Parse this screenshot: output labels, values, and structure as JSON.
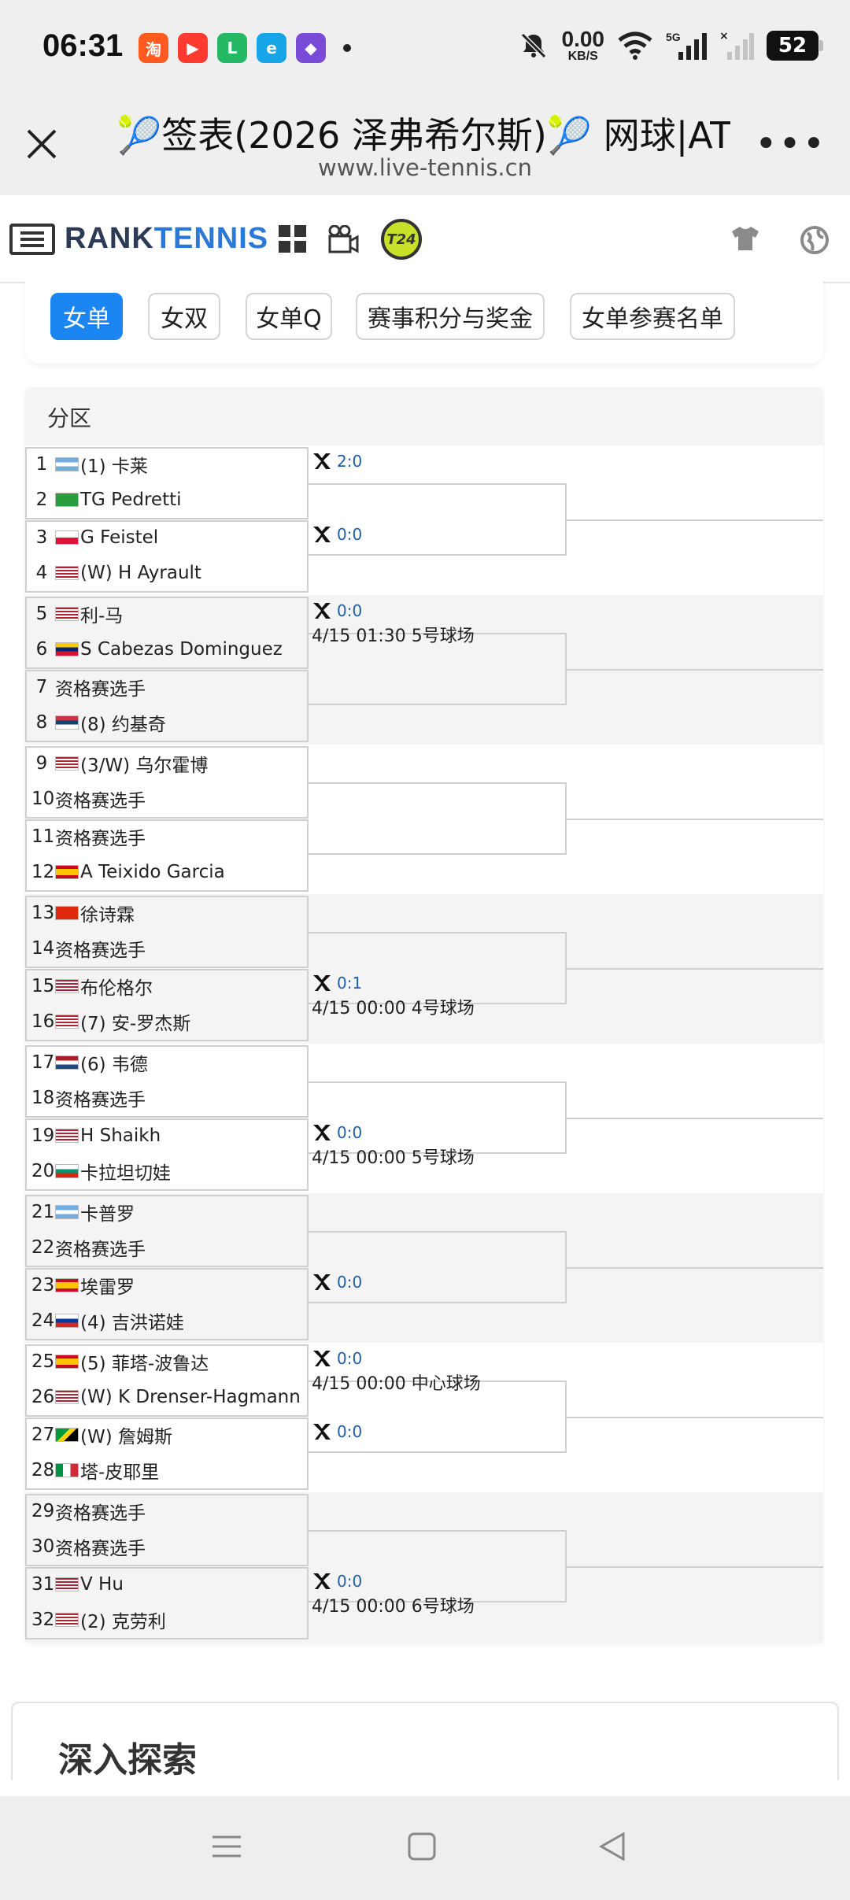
{
  "status": {
    "time": "06:31",
    "net_speed": "0.00",
    "net_unit": "KB/S",
    "network": "5G",
    "battery": "52",
    "apps": [
      {
        "icon": "taobao-app-icon",
        "glyph": "淘",
        "color": "#ff5a1f"
      },
      {
        "icon": "video-app-icon",
        "glyph": "▶",
        "color": "#ff3b30"
      },
      {
        "icon": "green-app-icon",
        "glyph": "L",
        "color": "#25b865"
      },
      {
        "icon": "browser-app-icon",
        "glyph": "e",
        "color": "#18a5e8"
      },
      {
        "icon": "game-app-icon",
        "glyph": "◆",
        "color": "#7a4bd6"
      }
    ]
  },
  "titlebar": {
    "title": "🎾签表(2026 泽弗希尔斯)🎾 网球|AT...",
    "url": "www.live-tennis.cn"
  },
  "site": {
    "brand_a": "RANK",
    "brand_b": "TENNIS",
    "t24": "T24"
  },
  "tabs": [
    {
      "label": "女单",
      "active": true
    },
    {
      "label": "女双",
      "active": false
    },
    {
      "label": "女单Q",
      "active": false
    },
    {
      "label": "赛事积分与奖金",
      "active": false
    },
    {
      "label": "女单参赛名单",
      "active": false
    }
  ],
  "bracket": {
    "section_label": "分区",
    "players": [
      {
        "num": "1",
        "flag": "ARG",
        "name": "(1) 卡莱"
      },
      {
        "num": "2",
        "flag": "BRA",
        "name": "TG Pedretti"
      },
      {
        "num": "3",
        "flag": "POL",
        "name": "G Feistel"
      },
      {
        "num": "4",
        "flag": "USA",
        "name": "(W) H Ayrault"
      },
      {
        "num": "5",
        "flag": "USA",
        "name": "利-马"
      },
      {
        "num": "6",
        "flag": "VEN",
        "name": "S Cabezas Dominguez"
      },
      {
        "num": "7",
        "flag": "",
        "name": "资格赛选手"
      },
      {
        "num": "8",
        "flag": "SRB",
        "name": "(8) 约基奇"
      },
      {
        "num": "9",
        "flag": "USA",
        "name": "(3/W) 乌尔霍博"
      },
      {
        "num": "10",
        "flag": "",
        "name": "资格赛选手"
      },
      {
        "num": "11",
        "flag": "",
        "name": "资格赛选手"
      },
      {
        "num": "12",
        "flag": "ESP",
        "name": "A Teixido Garcia"
      },
      {
        "num": "13",
        "flag": "CHN",
        "name": "徐诗霖"
      },
      {
        "num": "14",
        "flag": "",
        "name": "资格赛选手"
      },
      {
        "num": "15",
        "flag": "USA",
        "name": "布伦格尔"
      },
      {
        "num": "16",
        "flag": "USA",
        "name": "(7) 安-罗杰斯"
      },
      {
        "num": "17",
        "flag": "NED",
        "name": "(6) 韦德"
      },
      {
        "num": "18",
        "flag": "",
        "name": "资格赛选手"
      },
      {
        "num": "19",
        "flag": "USA",
        "name": "H Shaikh"
      },
      {
        "num": "20",
        "flag": "BUL",
        "name": "卡拉坦切娃"
      },
      {
        "num": "21",
        "flag": "ARG",
        "name": "卡普罗"
      },
      {
        "num": "22",
        "flag": "",
        "name": "资格赛选手"
      },
      {
        "num": "23",
        "flag": "ESP",
        "name": "埃雷罗"
      },
      {
        "num": "24",
        "flag": "RUS",
        "name": "(4) 吉洪诺娃"
      },
      {
        "num": "25",
        "flag": "ESP",
        "name": "(5) 菲塔-波鲁达"
      },
      {
        "num": "26",
        "flag": "USA",
        "name": "(W) K Drenser-Hagmann"
      },
      {
        "num": "27",
        "flag": "JAM",
        "name": "(W) 詹姆斯"
      },
      {
        "num": "28",
        "flag": "ITA",
        "name": "塔-皮耶里"
      },
      {
        "num": "29",
        "flag": "",
        "name": "资格赛选手"
      },
      {
        "num": "30",
        "flag": "",
        "name": "资格赛选手"
      },
      {
        "num": "31",
        "flag": "USA",
        "name": "V Hu"
      },
      {
        "num": "32",
        "flag": "USA",
        "name": "(2) 克劳利"
      }
    ],
    "matches": [
      {
        "score": "2:0",
        "sched": ""
      },
      {
        "score": "0:0",
        "sched": ""
      },
      {
        "score": "0:0",
        "sched": "4/15 01:30 5号球场"
      },
      {
        "score": "",
        "sched": ""
      },
      {
        "score": "",
        "sched": ""
      },
      {
        "score": "",
        "sched": ""
      },
      {
        "score": "",
        "sched": ""
      },
      {
        "score": "0:1",
        "sched": "4/15 00:00 4号球场"
      },
      {
        "score": "",
        "sched": ""
      },
      {
        "score": "0:0",
        "sched": "4/15 00:00 5号球场"
      },
      {
        "score": "",
        "sched": ""
      },
      {
        "score": "0:0",
        "sched": ""
      },
      {
        "score": "0:0",
        "sched": "4/15 00:00 中心球场"
      },
      {
        "score": "0:0",
        "sched": ""
      },
      {
        "score": "",
        "sched": ""
      },
      {
        "score": "0:0",
        "sched": "4/15 00:00 6号球场"
      }
    ]
  },
  "explore": {
    "title": "深入探索"
  },
  "colors": {
    "accent": "#1b86f1",
    "score": "#1f5fa8",
    "brand_dark": "#2b3a55",
    "brand_blue": "#2a78d8"
  }
}
